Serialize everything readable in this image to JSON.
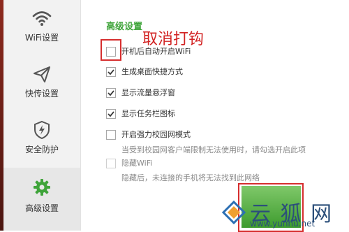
{
  "sidebar": {
    "items": [
      {
        "label": "WiFi设置",
        "icon": "wifi-icon"
      },
      {
        "label": "快传设置",
        "icon": "paper-plane-icon"
      },
      {
        "label": "安全防护",
        "icon": "shield-icon"
      },
      {
        "label": "高级设置",
        "icon": "gear-icon",
        "active": true
      }
    ]
  },
  "main": {
    "section_title": "高级设置",
    "annotation": "取消打钩",
    "options": [
      {
        "label": "开机后自动开启WiFi",
        "checked": false
      },
      {
        "label": "生成桌面快捷方式",
        "checked": true
      },
      {
        "label": "显示流量悬浮窗",
        "checked": true
      },
      {
        "label": "显示任务栏图标",
        "checked": true
      },
      {
        "label": "开启强力校园网模式",
        "checked": false,
        "description": "当受到校园网客户端限制无法使用时，请勾选开启此项"
      },
      {
        "label": "隐藏WiFi",
        "checked": false,
        "disabled": true,
        "description": "隐藏后，未连接的手机将无法找到此网络"
      }
    ]
  },
  "watermark": {
    "title": "云 狐 网",
    "url": "www.yunhu.net"
  },
  "colors": {
    "accent_green": "#3fa43a",
    "annotation_red": "#d22222",
    "sidebar_bg": "#f2f2f2"
  }
}
